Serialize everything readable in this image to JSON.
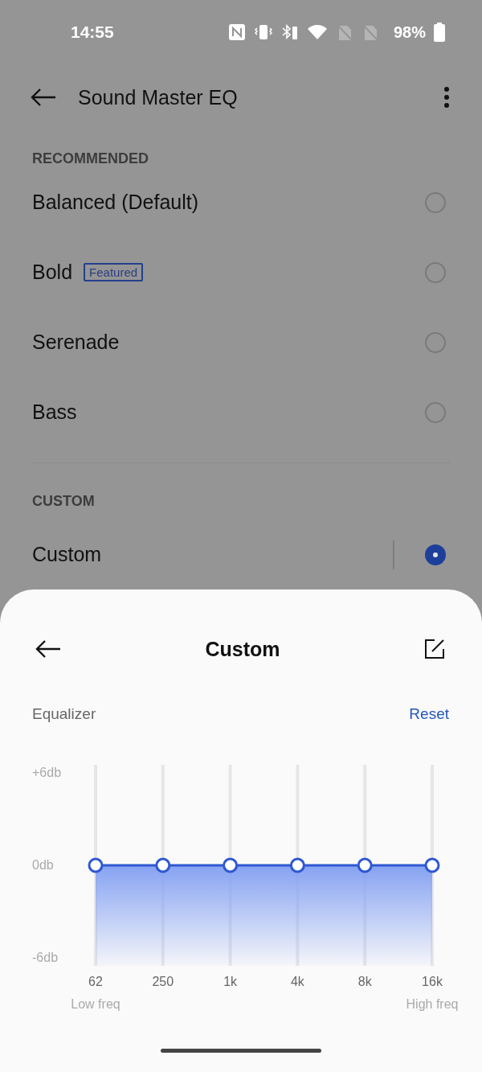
{
  "status_bar": {
    "time": "14:55",
    "battery": "98%"
  },
  "header": {
    "title": "Sound Master EQ"
  },
  "sections": [
    {
      "heading": "RECOMMENDED",
      "items": [
        {
          "label": "Balanced (Default)",
          "selected": false,
          "kind": "preset"
        },
        {
          "label": "Bold",
          "badge": "Featured",
          "selected": false,
          "kind": "preset"
        },
        {
          "label": "Serenade",
          "selected": false,
          "kind": "preset"
        },
        {
          "label": "Bass",
          "selected": false,
          "kind": "preset"
        }
      ]
    },
    {
      "heading": "CUSTOM",
      "items": [
        {
          "label": "Custom",
          "selected": true,
          "kind": "custom"
        }
      ]
    }
  ],
  "sheet": {
    "title": "Custom",
    "section_label": "Equalizer",
    "action": "Reset",
    "range_labels": [
      "Low freq",
      "High freq"
    ],
    "chart_data": {
      "type": "line",
      "categories": [
        "62",
        "250",
        "1k",
        "4k",
        "8k",
        "16k"
      ],
      "grid": true,
      "series": [
        {
          "color": "#2f58d0",
          "marker": "circle",
          "values": [
            0,
            0,
            0,
            0,
            0,
            0
          ]
        }
      ],
      "ylim": [
        -6.5,
        6.5
      ],
      "yticks": [
        {
          "value": 6,
          "label": "+6db"
        },
        {
          "value": 0,
          "label": "0db"
        },
        {
          "value": -6,
          "label": "-6db"
        }
      ]
    }
  }
}
